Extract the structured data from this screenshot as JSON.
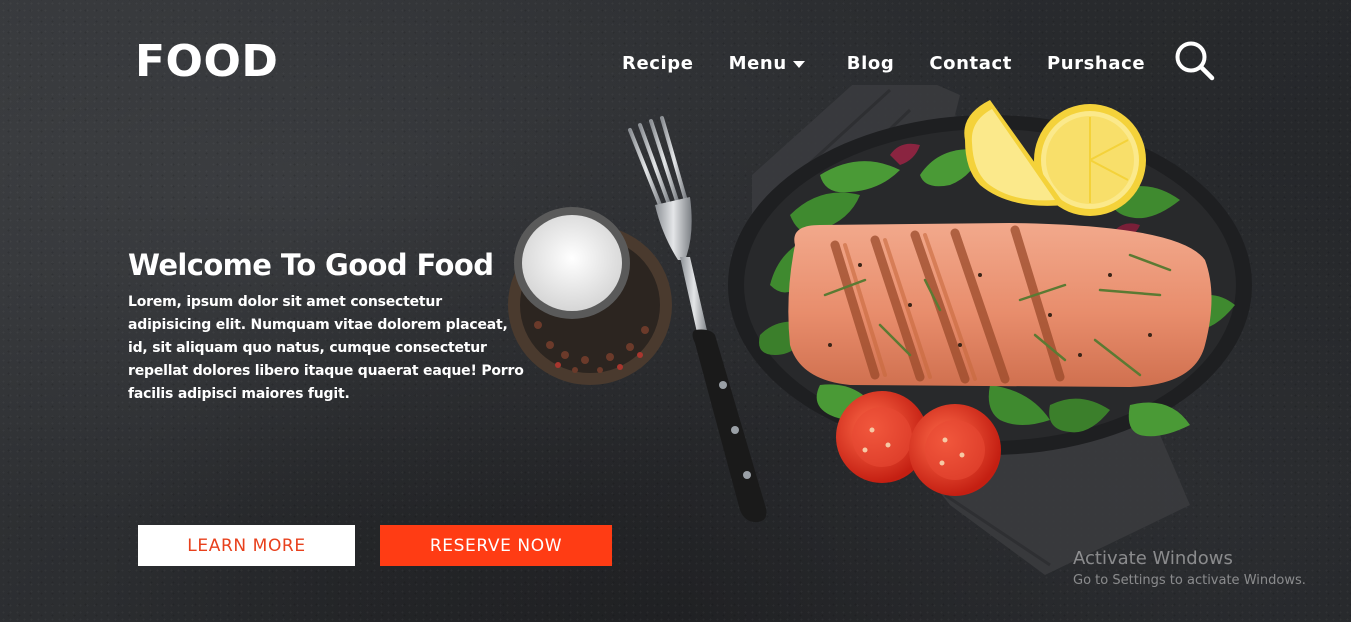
{
  "brand": {
    "logo": "FOOD"
  },
  "nav": {
    "items": [
      {
        "label": "Recipe"
      },
      {
        "label": "Menu"
      },
      {
        "label": "Blog"
      },
      {
        "label": "Contact"
      },
      {
        "label": "Purshace"
      }
    ],
    "search_icon": "search-icon"
  },
  "hero": {
    "headline": "Welcome To Good Food",
    "intro": "Lorem, ipsum dolor sit amet consectetur adipisicing elit. Numquam vitae dolorem placeat, id, sit aliquam quo natus, cumque consectetur repellat dolores libero itaque quaerat eaque! Porro facilis adipisci maiores fugit.",
    "learn_more_label": "LEARN MORE",
    "reserve_now_label": "RESERVE NOW"
  },
  "windows_watermark": {
    "title": "Activate Windows",
    "subtitle": "Go to Settings to activate Windows."
  },
  "colors": {
    "background": "#2b2d30",
    "accent": "#ff3c14",
    "learn_more_text": "#e8401c",
    "text": "#ffffff"
  }
}
